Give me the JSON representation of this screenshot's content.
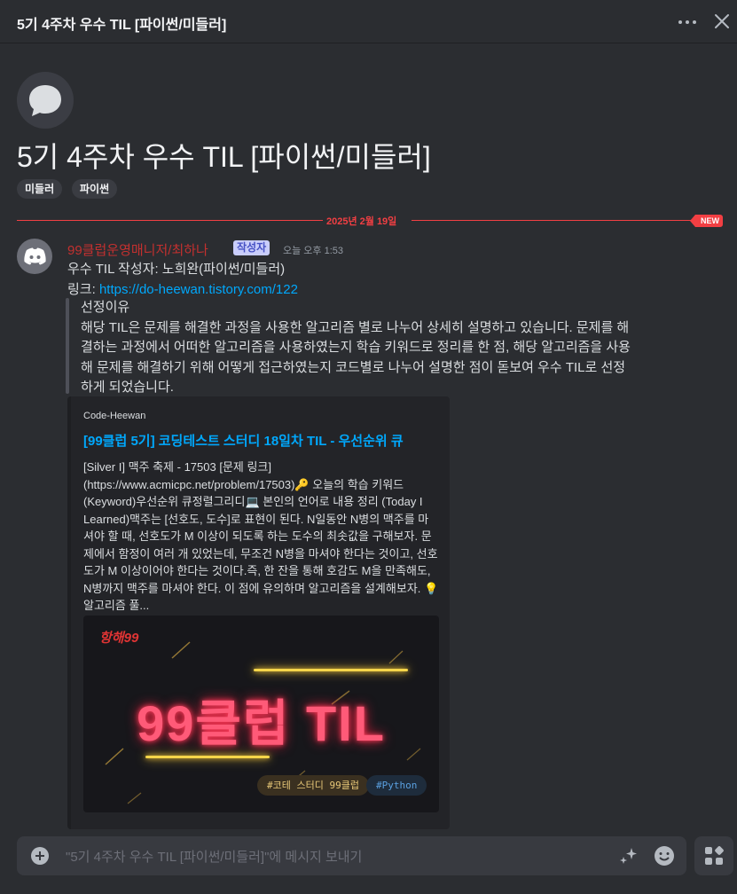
{
  "header": {
    "title": "5기 4주차 우수 TIL [파이썬/미들러]"
  },
  "thread": {
    "title": "5기 4주차 우수 TIL [파이썬/미들러]",
    "tags": [
      "미들러",
      "파이썬"
    ]
  },
  "divider": {
    "date": "2025년 2월 19일",
    "new_label": "NEW"
  },
  "message": {
    "author": "99클럽운영매니저/최하나",
    "op_badge": "작성자",
    "timestamp": "오늘 오후 1:53",
    "line1": "우수 TIL 작성자: 노희완(파이썬/미들러)",
    "link_prefix": "링크: ",
    "link_url": "https://do-heewan.tistory.com/122",
    "quote_heading": "선정이유",
    "quote_body": "해당 TIL은 문제를 해결한 과정을 사용한 알고리즘 별로 나누어 상세히 설명하고 있습니다. 문제를 해결하는 과정에서 어떠한 알고리즘을 사용하였는지 학습 키워드로 정리를 한 점, 해당 알고리즘을 사용해 문제를 해결하기 위해 어떻게 접근하였는지 코드별로 나누어 설명한 점이 돋보여 우수 TIL로 선정하게 되었습니다."
  },
  "embed": {
    "provider": "Code-Heewan",
    "title": "[99클럽 5기] 코딩테스트 스터디 18일차 TIL - 우선순위 큐",
    "description": "[Silver I] 맥주 축제 - 17503 [문제 링크](https://www.acmicpc.net/problem/17503)🔑 오늘의 학습 키워드 (Keyword)우선순위 큐정렬그리디💻 본인의 언어로 내용 정리 (Today I Learned)맥주는 [선호도, 도수]로 표현이 된다. N일동안 N병의 맥주를 마셔야 할 때, 선호도가 M 이상이 되도록 하는 도수의 최솟값을 구해보자. 문제에서 함정이 여러 개 있었는데, 무조건 N병을 마셔야 한다는 것이고, 선호도가 M 이상이어야 한다는 것이다.즉, 한 잔을 통해 호감도 M을 만족해도, N병까지 맥주를 마셔야 한다. 이 점에 유의하며 알고리즘을 설계해보자. 💡 알고리즘 풀...",
    "image": {
      "logo": "항해99",
      "headline": "99클럽 TIL",
      "tags": [
        "#코테 스터디 99클럽",
        "#Python"
      ]
    }
  },
  "composer": {
    "placeholder": "\"5기 4주차 우수 TIL [파이썬/미들러]\"에 메시지 보내기"
  },
  "colors": {
    "accent": "#f23f43",
    "link": "#00a8fc",
    "author": "#c3302f",
    "background": "#2b2d31"
  }
}
